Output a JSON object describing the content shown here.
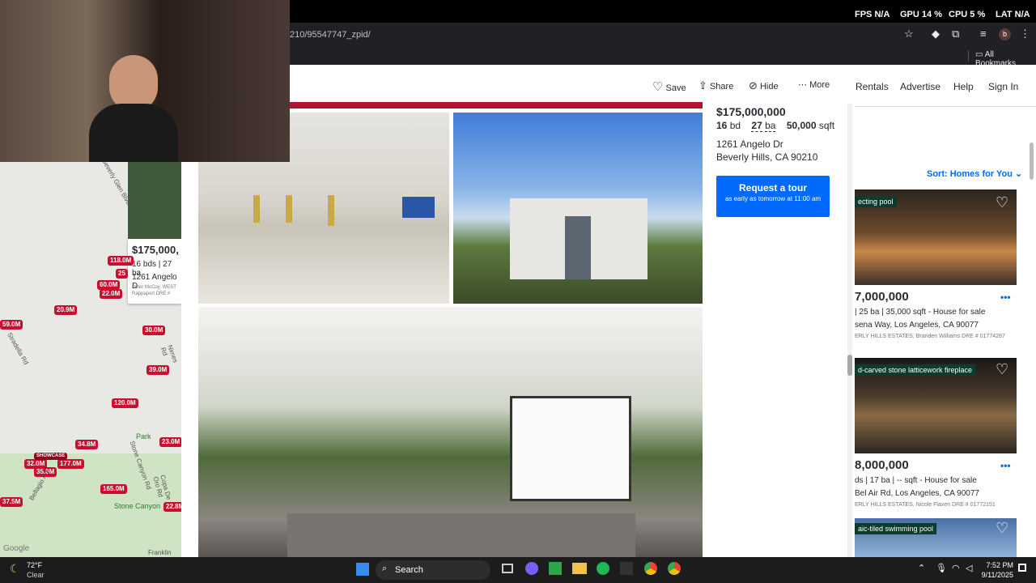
{
  "browser": {
    "url": "210/95547747_zpid/",
    "bookmarks_label": "All Bookmarks",
    "hud": {
      "fps_label": "FPS",
      "fps_value": "N/A",
      "gpu_label": "GPU",
      "gpu_value": "14 %",
      "cpu_label": "CPU",
      "cpu_value": "5 %",
      "lat_label": "LAT",
      "lat_value": "N/A"
    }
  },
  "modal_actions": {
    "save": "Save",
    "share": "Share",
    "hide": "Hide",
    "more": "More"
  },
  "listing": {
    "price": "$175,000,000",
    "beds_value": "16",
    "beds_unit": "bd",
    "baths_value": "27",
    "baths_unit": "ba",
    "sqft_value": "50,000",
    "sqft_unit": "sqft",
    "address_line1": "1261 Angelo Dr",
    "address_line2": "Beverly Hills, CA 90210",
    "cta_title": "Request a tour",
    "cta_sub": "as early as tomorrow at 11:00 am"
  },
  "site_nav": {
    "rentals": "Rentals",
    "advertise": "Advertise",
    "help": "Help",
    "signin": "Sign In"
  },
  "sort": {
    "label": "Sort: Homes for You"
  },
  "cards": [
    {
      "tag": "ecting pool",
      "price": "7,000,000",
      "details": "| 25 ba | 35,000 sqft - House for sale",
      "address": "sena Way, Los Angeles, CA 90077",
      "broker": "ERLY HILLS ESTATES, Branden Williams DRE # 01774287"
    },
    {
      "tag": "d-carved stone latticework fireplace",
      "price": "8,000,000",
      "details": "ds | 17 ba | -- sqft - House for sale",
      "address": "Bel Air Rd, Los Angeles, CA 90077",
      "broker": "ERLY HILLS ESTATES, Nicole Flaxen DRE # 01772151"
    },
    {
      "tag": "aic-tiled swimming pool"
    }
  ],
  "map_card": {
    "price": "$175,000,",
    "details": "16 bds | 27 ba",
    "address": "1261 Angelo D",
    "broker": "Peter McCoy, WEST",
    "broker2": "Rappaport DRE #"
  },
  "map_pins": [
    "118.0M",
    "60.0M",
    "22.0M",
    "25",
    "20.9M",
    "59.0M",
    "30.0M",
    "39.0M",
    "120.0M",
    "34.8M",
    "32.0M",
    "177.0M",
    "35.0M",
    "165.0M",
    "23.0M",
    "37.5M",
    "22.8M"
  ],
  "map_roads": [
    "Beverly Glen Blvd",
    "Stradella Rd",
    "Nimes Rd",
    "Park",
    "Stone Canyon",
    "Bellagio Rd",
    "Franklin",
    "Stone Canyon Rd",
    "Copa De Oro Rd"
  ],
  "map_pin_label": "SHOWCASE",
  "google_label": "Google",
  "taskbar": {
    "weather_temp": "72°F",
    "weather_desc": "Clear",
    "search": "Search",
    "time": "7:52 PM",
    "date": "9/11/2025"
  }
}
